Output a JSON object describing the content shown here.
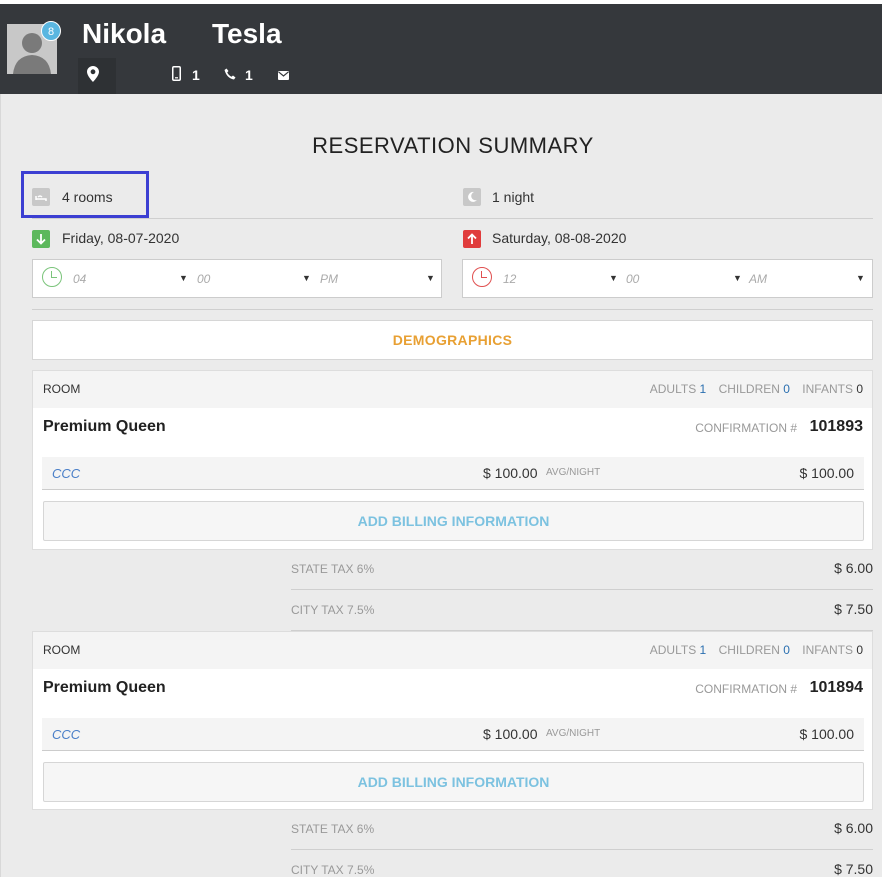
{
  "header": {
    "first_name": "Nikola",
    "last_name": "Tesla",
    "badge_count": "8",
    "mobile_count": "1",
    "phone_count": "1",
    "icons": [
      "avatar",
      "map-pin-icon",
      "mobile-icon",
      "phone-icon",
      "mail-icon"
    ]
  },
  "summary": {
    "title": "RESERVATION SUMMARY",
    "rooms": "4 rooms",
    "nights": "1 night",
    "checkin_date": "Friday, 08-07-2020",
    "checkout_date": "Saturday, 08-08-2020",
    "checkin_time": {
      "hour": "04",
      "minute": "00",
      "ampm": "PM"
    },
    "checkout_time": {
      "hour": "12",
      "minute": "00",
      "ampm": "AM"
    },
    "colors": {
      "checkin": "#5cb85c",
      "checkout": "#e03c3c",
      "highlight": "#3c3fd2"
    }
  },
  "demographics_label": "DEMOGRAPHICS",
  "rooms": [
    {
      "header_label": "ROOM",
      "adults_label": "ADULTS",
      "adults": "1",
      "children_label": "CHILDREN",
      "children": "0",
      "infants_label": "INFANTS",
      "infants": "0",
      "name": "Premium Queen",
      "confirmation_label": "CONFIRMATION #",
      "confirmation": "101893",
      "rate_code": "CCC",
      "rate": "$ 100.00",
      "avg_label": "AVG/NIGHT",
      "total": "$ 100.00",
      "billing_label": "ADD BILLING INFORMATION",
      "taxes": [
        {
          "label": "STATE TAX 6%",
          "amount": "$ 6.00"
        },
        {
          "label": "CITY TAX 7.5%",
          "amount": "$ 7.50"
        }
      ]
    },
    {
      "header_label": "ROOM",
      "adults_label": "ADULTS",
      "adults": "1",
      "children_label": "CHILDREN",
      "children": "0",
      "infants_label": "INFANTS",
      "infants": "0",
      "name": "Premium Queen",
      "confirmation_label": "CONFIRMATION #",
      "confirmation": "101894",
      "rate_code": "CCC",
      "rate": "$ 100.00",
      "avg_label": "AVG/NIGHT",
      "total": "$ 100.00",
      "billing_label": "ADD BILLING INFORMATION",
      "taxes": [
        {
          "label": "STATE TAX 6%",
          "amount": "$ 6.00"
        },
        {
          "label": "CITY TAX 7.5%",
          "amount": "$ 7.50"
        }
      ]
    }
  ]
}
